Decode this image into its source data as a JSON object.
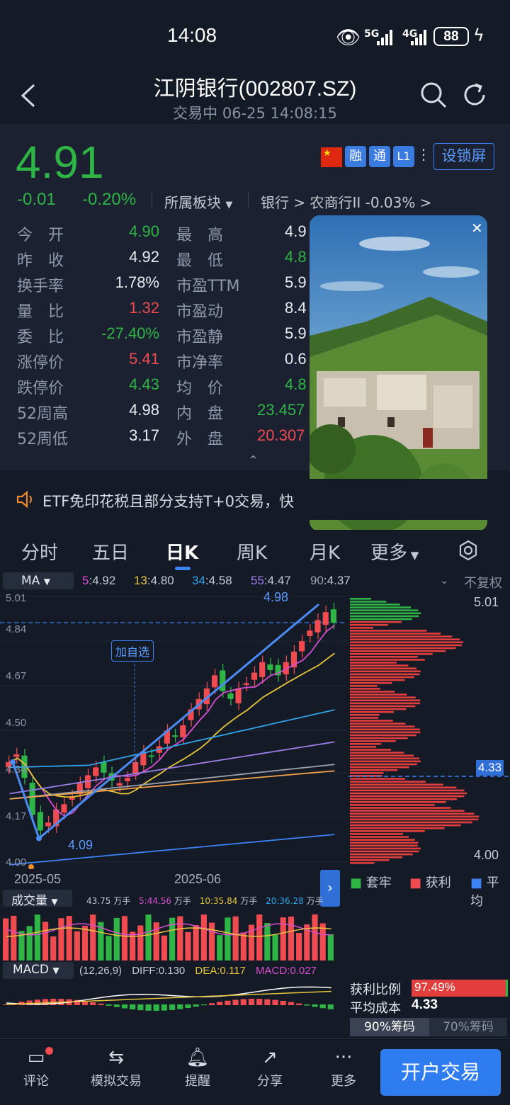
{
  "status": {
    "time": "14:08",
    "signal1": "5G",
    "signal2": "4G",
    "battery": "88"
  },
  "header": {
    "title": "江阴银行(002807.SZ)",
    "subtitle": "交易中 06-25 14:08:15"
  },
  "quote": {
    "price": "4.91",
    "change": "-0.01",
    "change_pct": "-0.20%",
    "sector_label": "所属板块",
    "sector_path": "银行 > 农商行II -0.03% >",
    "badges": [
      "融",
      "通",
      "L1"
    ],
    "lock_button": "设锁屏",
    "rows_left": [
      {
        "label": "今　开",
        "value": "4.90",
        "color": "green"
      },
      {
        "label": "昨　收",
        "value": "4.92",
        "color": "white"
      },
      {
        "label": "换手率",
        "value": "1.78%",
        "color": "white"
      },
      {
        "label": "量　比",
        "value": "1.32",
        "color": "red"
      },
      {
        "label": "委　比",
        "value": "-27.40%",
        "color": "green"
      },
      {
        "label": "涨停价",
        "value": "5.41",
        "color": "red"
      },
      {
        "label": "跌停价",
        "value": "4.43",
        "color": "green"
      },
      {
        "label": "52周高",
        "value": "4.98",
        "color": "white"
      },
      {
        "label": "52周低",
        "value": "3.17",
        "color": "white"
      }
    ],
    "rows_mid": [
      {
        "label": "最　高",
        "value": "4.9",
        "color": "white"
      },
      {
        "label": "最　低",
        "value": "4.8",
        "color": "green"
      },
      {
        "label": "市盈TTM",
        "value": "5.9",
        "color": "white"
      },
      {
        "label": "市盈动",
        "value": "8.4",
        "color": "white"
      },
      {
        "label": "市盈静",
        "value": "5.9",
        "color": "white"
      },
      {
        "label": "市净率",
        "value": "0.6",
        "color": "white"
      },
      {
        "label": "均　价",
        "value": "4.8",
        "color": "green"
      },
      {
        "label": "内　盘",
        "value": "23.457",
        "color": "green"
      },
      {
        "label": "外　盘",
        "value": "20.307",
        "color": "red"
      }
    ]
  },
  "notice": {
    "text": "ETF免印花税且部分支持T+0交易，快"
  },
  "tabs": [
    "分时",
    "五日",
    "日K",
    "周K",
    "月K",
    "更多"
  ],
  "chart": {
    "ma_label": "MA",
    "fq_label": "不复权",
    "ma_values": [
      {
        "n": "5",
        "v": "4.92",
        "color": "#d64fd0"
      },
      {
        "n": "13",
        "v": "4.80",
        "color": "#e6c53a"
      },
      {
        "n": "34",
        "v": "4.58",
        "color": "#2fa4e7"
      },
      {
        "n": "55",
        "v": "4.47",
        "color": "#9b7de6"
      },
      {
        "n": "90",
        "v": "4.37",
        "color": "#9aa0ac"
      }
    ],
    "y_ticks": [
      "5.01",
      "4.84",
      "4.67",
      "4.50",
      "4.34",
      "4.17",
      "4.00"
    ],
    "x_ticks": [
      "2025-05",
      "2025-06"
    ],
    "high_label": "4.98",
    "low_label": "4.09",
    "add_watch": "加自选",
    "dist_top": "5.01",
    "dist_bottom": "4.00",
    "dist_avg": "4.33",
    "legend": [
      "套牢",
      "获利",
      "平均"
    ],
    "volume": {
      "label": "成交量",
      "v": "43.75",
      "ma5": "5:44.56",
      "ma10": "10:35.84",
      "ma20": "20:36.28",
      "unit": "万手"
    },
    "macd": {
      "label": "MACD",
      "params": "(12,26,9)",
      "diff": "DIFF:0.130",
      "dea": "DEA:0.117",
      "macd": "MACD:0.027"
    },
    "profit_ratio_label": "获利比例",
    "profit_ratio": "97.49%",
    "profit_ratio_value": 0.9749,
    "avg_cost_label": "平均成本",
    "avg_cost": "4.33",
    "chip_tabs": [
      "90%筹码",
      "70%筹码"
    ],
    "candles": [
      4.38,
      4.41,
      4.32,
      4.18,
      4.12,
      4.15,
      4.2,
      4.22,
      4.25,
      4.3,
      4.33,
      4.36,
      4.34,
      4.31,
      4.3,
      4.32,
      4.38,
      4.42,
      4.4,
      4.44,
      4.5,
      4.48,
      4.52,
      4.58,
      4.62,
      4.66,
      4.71,
      4.65,
      4.62,
      4.66,
      4.68,
      4.72,
      4.76,
      4.73,
      4.71,
      4.76,
      4.8,
      4.84,
      4.88,
      4.92,
      4.95,
      4.91
    ]
  },
  "nav": {
    "items": [
      "评论",
      "模拟交易",
      "提醒",
      "分享",
      "更多"
    ],
    "trade": "开户交易"
  }
}
